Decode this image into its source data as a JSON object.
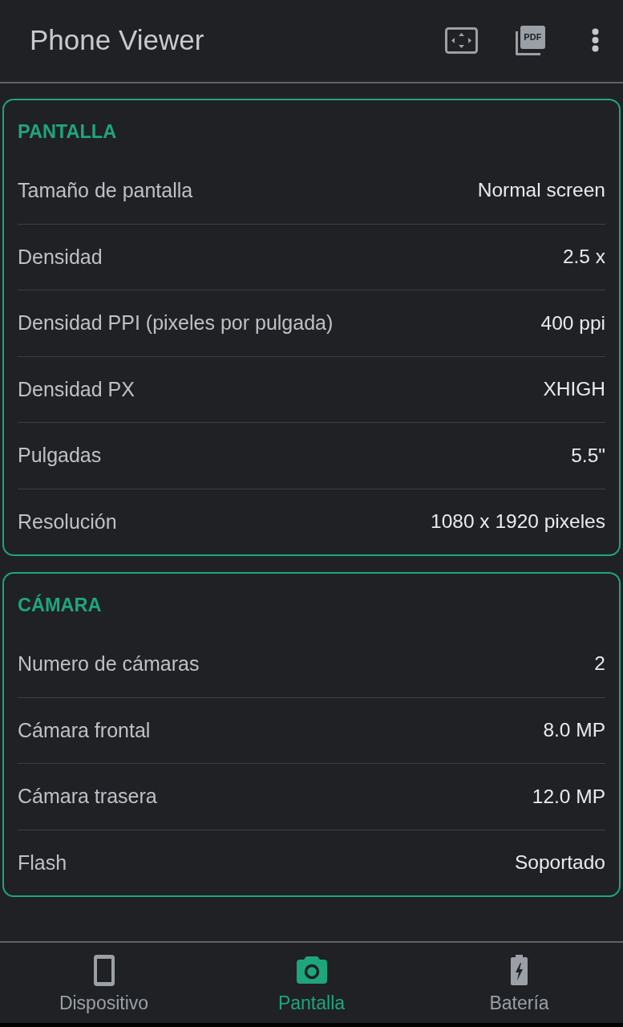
{
  "app_bar": {
    "title": "Phone Viewer",
    "pdf_icon_text": "PDF"
  },
  "sections": [
    {
      "title": "PANTALLA",
      "rows": [
        {
          "label": "Tamaño de pantalla",
          "value": "Normal screen"
        },
        {
          "label": "Densidad",
          "value": "2.5 x"
        },
        {
          "label": "Densidad PPI (pixeles por pulgada)",
          "value": "400 ppi"
        },
        {
          "label": "Densidad PX",
          "value": "XHIGH"
        },
        {
          "label": "Pulgadas",
          "value": "5.5\""
        },
        {
          "label": "Resolución",
          "value": "1080 x 1920 pixeles"
        }
      ]
    },
    {
      "title": "CÁMARA",
      "rows": [
        {
          "label": "Numero de cámaras",
          "value": "2"
        },
        {
          "label": "Cámara frontal",
          "value": "8.0 MP"
        },
        {
          "label": "Cámara trasera",
          "value": "12.0 MP"
        },
        {
          "label": "Flash",
          "value": "Soportado"
        }
      ]
    }
  ],
  "bottom_nav": [
    {
      "kind": "phone",
      "label": "Dispositivo",
      "selected": false
    },
    {
      "kind": "camera",
      "label": "Pantalla",
      "selected": true
    },
    {
      "kind": "battery",
      "label": "Batería",
      "selected": false
    }
  ]
}
